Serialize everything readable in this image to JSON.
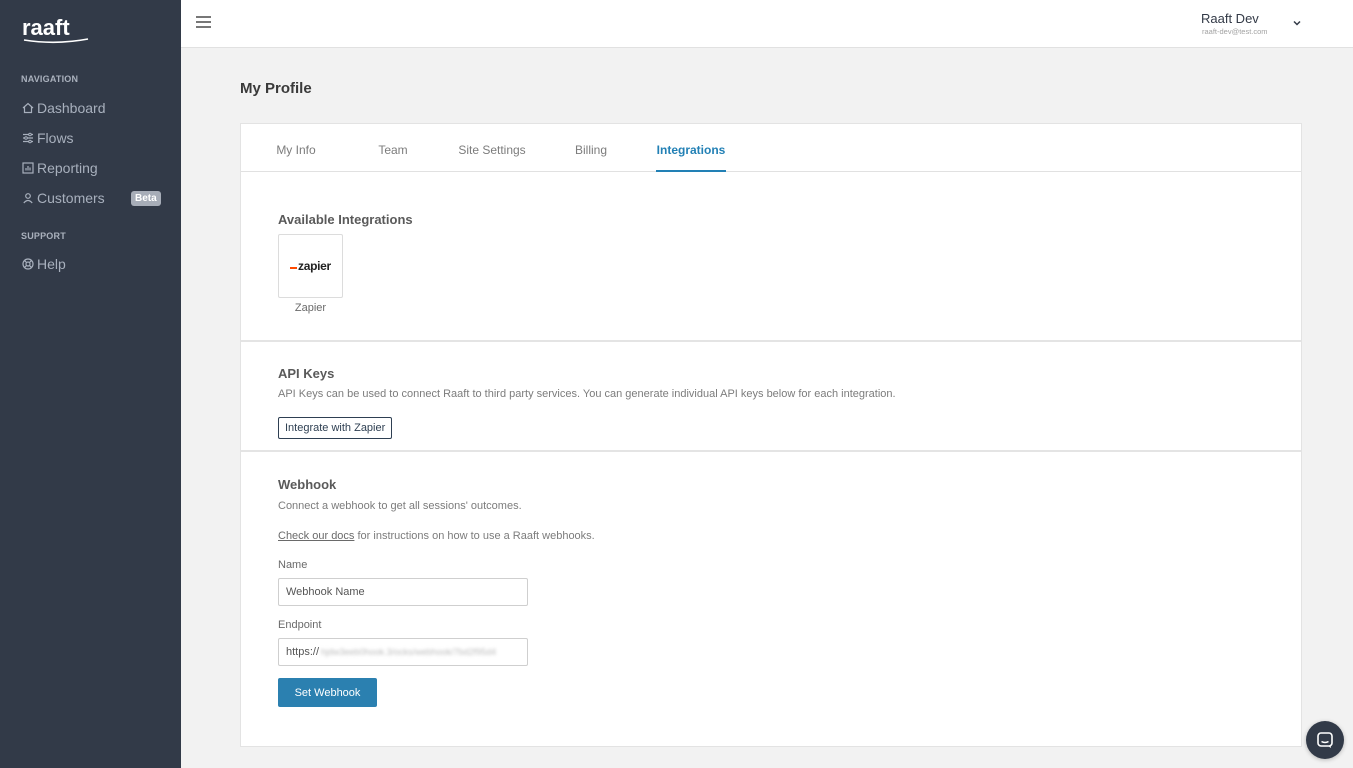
{
  "sidebar": {
    "logo_text": "raaft",
    "sections": [
      {
        "title": "NAVIGATION"
      },
      {
        "title": "SUPPORT"
      }
    ],
    "items": [
      {
        "label": "Dashboard",
        "icon": "home-icon"
      },
      {
        "label": "Flows",
        "icon": "flows-icon"
      },
      {
        "label": "Reporting",
        "icon": "reporting-icon"
      },
      {
        "label": "Customers",
        "icon": "user-icon",
        "badge": "Beta"
      },
      {
        "label": "Help",
        "icon": "help-icon"
      }
    ]
  },
  "header": {
    "user_name": "Raaft Dev",
    "user_email": "raaft-dev@test.com"
  },
  "main": {
    "page_title": "My Profile",
    "tabs": [
      {
        "label": "My Info"
      },
      {
        "label": "Team"
      },
      {
        "label": "Site Settings"
      },
      {
        "label": "Billing"
      },
      {
        "label": "Integrations",
        "active": true
      }
    ],
    "available_integrations": {
      "title": "Available Integrations",
      "items": [
        {
          "logo_text": "zapier",
          "name": "Zapier"
        }
      ]
    },
    "api_keys": {
      "title": "API Keys",
      "description": "API Keys can be used to connect Raaft to third party services. You can generate individual API keys below for each integration.",
      "button_label": "Integrate with Zapier"
    },
    "webhook": {
      "title": "Webhook",
      "description": "Connect a webhook to get all sessions' outcomes.",
      "docs_link": "Check our docs",
      "docs_text": " for instructions on how to use a Raaft webhooks.",
      "name_label": "Name",
      "name_placeholder": "Webhook Name",
      "endpoint_label": "Endpoint",
      "endpoint_prefix": "https://",
      "endpoint_value_blurred": "hjdw3eeb0hook.3/ocks/webhook/7bd2f95d4",
      "submit_label": "Set Webhook"
    }
  },
  "colors": {
    "sidebar_bg": "#323a48",
    "accent": "#2b80b0",
    "zapier_orange": "#ff4a00"
  }
}
